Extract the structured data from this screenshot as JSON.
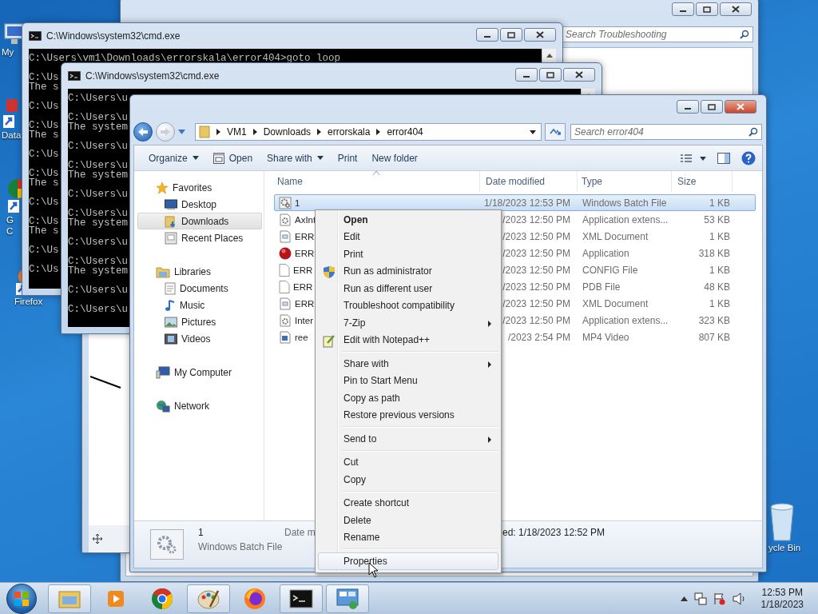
{
  "desktop_icons": [
    {
      "kind": "computer",
      "lines": [
        "My"
      ]
    },
    {
      "kind": "shortcut",
      "lines": [
        "Data"
      ]
    },
    {
      "kind": "chrome",
      "lines": [
        "G",
        "C"
      ]
    },
    {
      "kind": "firefox",
      "lines": [
        "Firefox"
      ]
    },
    {
      "kind": "recycle",
      "lines": [
        "ycle Bin"
      ]
    }
  ],
  "background_window": {
    "search_placeholder": "Search Troubleshooting"
  },
  "consoles": [
    {
      "title": "C:\\Windows\\system32\\cmd.exe",
      "blocks": [
        [
          "C:\\Users\\vm1\\Downloads\\errorskala\\error404>goto loop"
        ],
        [
          "C:\\Us",
          "The s"
        ],
        [
          "C:\\Us"
        ],
        [
          "C:\\Us",
          "The s"
        ],
        [
          "C:\\Us"
        ],
        [
          "C:\\Us",
          "The s"
        ],
        [
          "C:\\Us"
        ],
        [
          "C:\\Us",
          "The s"
        ],
        [
          "C:\\Us"
        ],
        [
          "C:\\Us"
        ]
      ]
    },
    {
      "title": "C:\\Windows\\system32\\cmd.exe",
      "blocks": [
        [
          "C:\\Users\\u"
        ],
        [
          "C:\\Users\\u",
          "The system"
        ],
        [
          "C:\\Users\\u"
        ],
        [
          "C:\\Users\\u",
          "The system"
        ],
        [
          "C:\\Users\\u"
        ],
        [
          "C:\\Users\\u",
          "The system"
        ],
        [
          "C:\\Users\\u"
        ],
        [
          "C:\\Users\\u",
          "The system"
        ],
        [
          "C:\\Users\\u"
        ],
        [
          "C:\\Users\\u"
        ]
      ]
    }
  ],
  "explorer": {
    "breadcrumb": [
      "VM1",
      "Downloads",
      "errorskala",
      "error404"
    ],
    "search_placeholder": "Search error404",
    "toolbar": [
      {
        "label": "Organize",
        "kind": "menu"
      },
      {
        "label": "Open",
        "kind": "open"
      },
      {
        "label": "Share with",
        "kind": "menu"
      },
      {
        "label": "Print",
        "kind": "plain"
      },
      {
        "label": "New folder",
        "kind": "plain"
      }
    ],
    "nav": [
      {
        "label": "Favorites",
        "kind": "star",
        "selected": false,
        "children": [
          {
            "label": "Desktop",
            "kind": "desktop",
            "selected": false
          },
          {
            "label": "Downloads",
            "kind": "downloads",
            "selected": true
          },
          {
            "label": "Recent Places",
            "kind": "recent",
            "selected": false
          }
        ]
      },
      {
        "label": "Libraries",
        "kind": "libraries",
        "selected": false,
        "children": [
          {
            "label": "Documents",
            "kind": "documents",
            "selected": false
          },
          {
            "label": "Music",
            "kind": "music",
            "selected": false
          },
          {
            "label": "Pictures",
            "kind": "pictures",
            "selected": false
          },
          {
            "label": "Videos",
            "kind": "videos",
            "selected": false
          }
        ]
      },
      {
        "label": "My Computer",
        "kind": "computer",
        "selected": false
      },
      {
        "label": "Network",
        "kind": "network",
        "selected": false
      }
    ],
    "columns": [
      "Name",
      "Date modified",
      "Type",
      "Size"
    ],
    "rows": [
      {
        "kind": "batch",
        "name": "1",
        "date": "1/18/2023 12:53 PM",
        "type": "Windows Batch File",
        "size": "1 KB",
        "selected": true
      },
      {
        "kind": "dll",
        "name": "AxInt",
        "date": "/2023 12:50 PM",
        "type": "Application extens...",
        "size": "53 KB",
        "selected": false
      },
      {
        "kind": "xml",
        "name": "ERR",
        "date": "/2023 12:50 PM",
        "type": "XML Document",
        "size": "1 KB",
        "selected": false
      },
      {
        "kind": "exe",
        "name": "ERR",
        "date": "/2023 12:50 PM",
        "type": "Application",
        "size": "318 KB",
        "selected": false
      },
      {
        "kind": "blank",
        "name": "ERR",
        "date": "/2023 12:50 PM",
        "type": "CONFIG File",
        "size": "1 KB",
        "selected": false
      },
      {
        "kind": "blank",
        "name": "ERR",
        "date": "/2023 12:50 PM",
        "type": "PDB File",
        "size": "48 KB",
        "selected": false
      },
      {
        "kind": "xml",
        "name": "ERR",
        "date": "/2023 12:50 PM",
        "type": "XML Document",
        "size": "1 KB",
        "selected": false
      },
      {
        "kind": "dll",
        "name": "Inter",
        "date": "/2023 12:50 PM",
        "type": "Application extens...",
        "size": "323 KB",
        "selected": false
      },
      {
        "kind": "video",
        "name": "ree",
        "date": "/2023 2:54 PM",
        "type": "MP4 Video",
        "size": "807 KB",
        "selected": false
      }
    ],
    "details": {
      "name": "1",
      "type": "Windows Batch File",
      "field_label": "Date m",
      "field_value": "ed: 1/18/2023 12:52 PM"
    }
  },
  "context_menu": {
    "groups": [
      [
        {
          "label": "Open",
          "bold": true,
          "submenu": false,
          "selected": false
        },
        {
          "label": "Edit",
          "bold": false,
          "submenu": false,
          "selected": false
        },
        {
          "label": "Print",
          "bold": false,
          "submenu": false,
          "selected": false
        },
        {
          "label": "Run as administrator",
          "kind": "shield",
          "bold": false,
          "submenu": false,
          "selected": false
        },
        {
          "label": "Run as different user",
          "bold": false,
          "submenu": false,
          "selected": false
        },
        {
          "label": "Troubleshoot compatibility",
          "bold": false,
          "submenu": false,
          "selected": false
        },
        {
          "label": "7-Zip",
          "bold": false,
          "submenu": true,
          "selected": false
        },
        {
          "label": "Edit with Notepad++",
          "kind": "notepad",
          "bold": false,
          "submenu": false,
          "selected": false
        }
      ],
      [
        {
          "label": "Share with",
          "bold": false,
          "submenu": true,
          "selected": false
        },
        {
          "label": "Pin to Start Menu",
          "bold": false,
          "submenu": false,
          "selected": false
        },
        {
          "label": "Copy as path",
          "bold": false,
          "submenu": false,
          "selected": false
        },
        {
          "label": "Restore previous versions",
          "bold": false,
          "submenu": false,
          "selected": false
        }
      ],
      [
        {
          "label": "Send to",
          "bold": false,
          "submenu": true,
          "selected": false
        }
      ],
      [
        {
          "label": "Cut",
          "bold": false,
          "submenu": false,
          "selected": false
        },
        {
          "label": "Copy",
          "bold": false,
          "submenu": false,
          "selected": false
        }
      ],
      [
        {
          "label": "Create shortcut",
          "bold": false,
          "submenu": false,
          "selected": false
        },
        {
          "label": "Delete",
          "bold": false,
          "submenu": false,
          "selected": false
        },
        {
          "label": "Rename",
          "bold": false,
          "submenu": false,
          "selected": false
        }
      ],
      [
        {
          "label": "Properties",
          "bold": false,
          "submenu": false,
          "selected": true
        }
      ]
    ]
  },
  "taskbar": {
    "apps": [
      {
        "kind": "explorer",
        "running": true
      },
      {
        "kind": "media",
        "running": false
      },
      {
        "kind": "chrome",
        "running": false
      },
      {
        "kind": "paint",
        "running": true
      },
      {
        "kind": "firefox",
        "running": false
      },
      {
        "kind": "cmd",
        "running": true
      },
      {
        "kind": "control",
        "running": true
      }
    ],
    "clock": {
      "time": "12:53 PM",
      "date": "1/18/2023"
    }
  }
}
